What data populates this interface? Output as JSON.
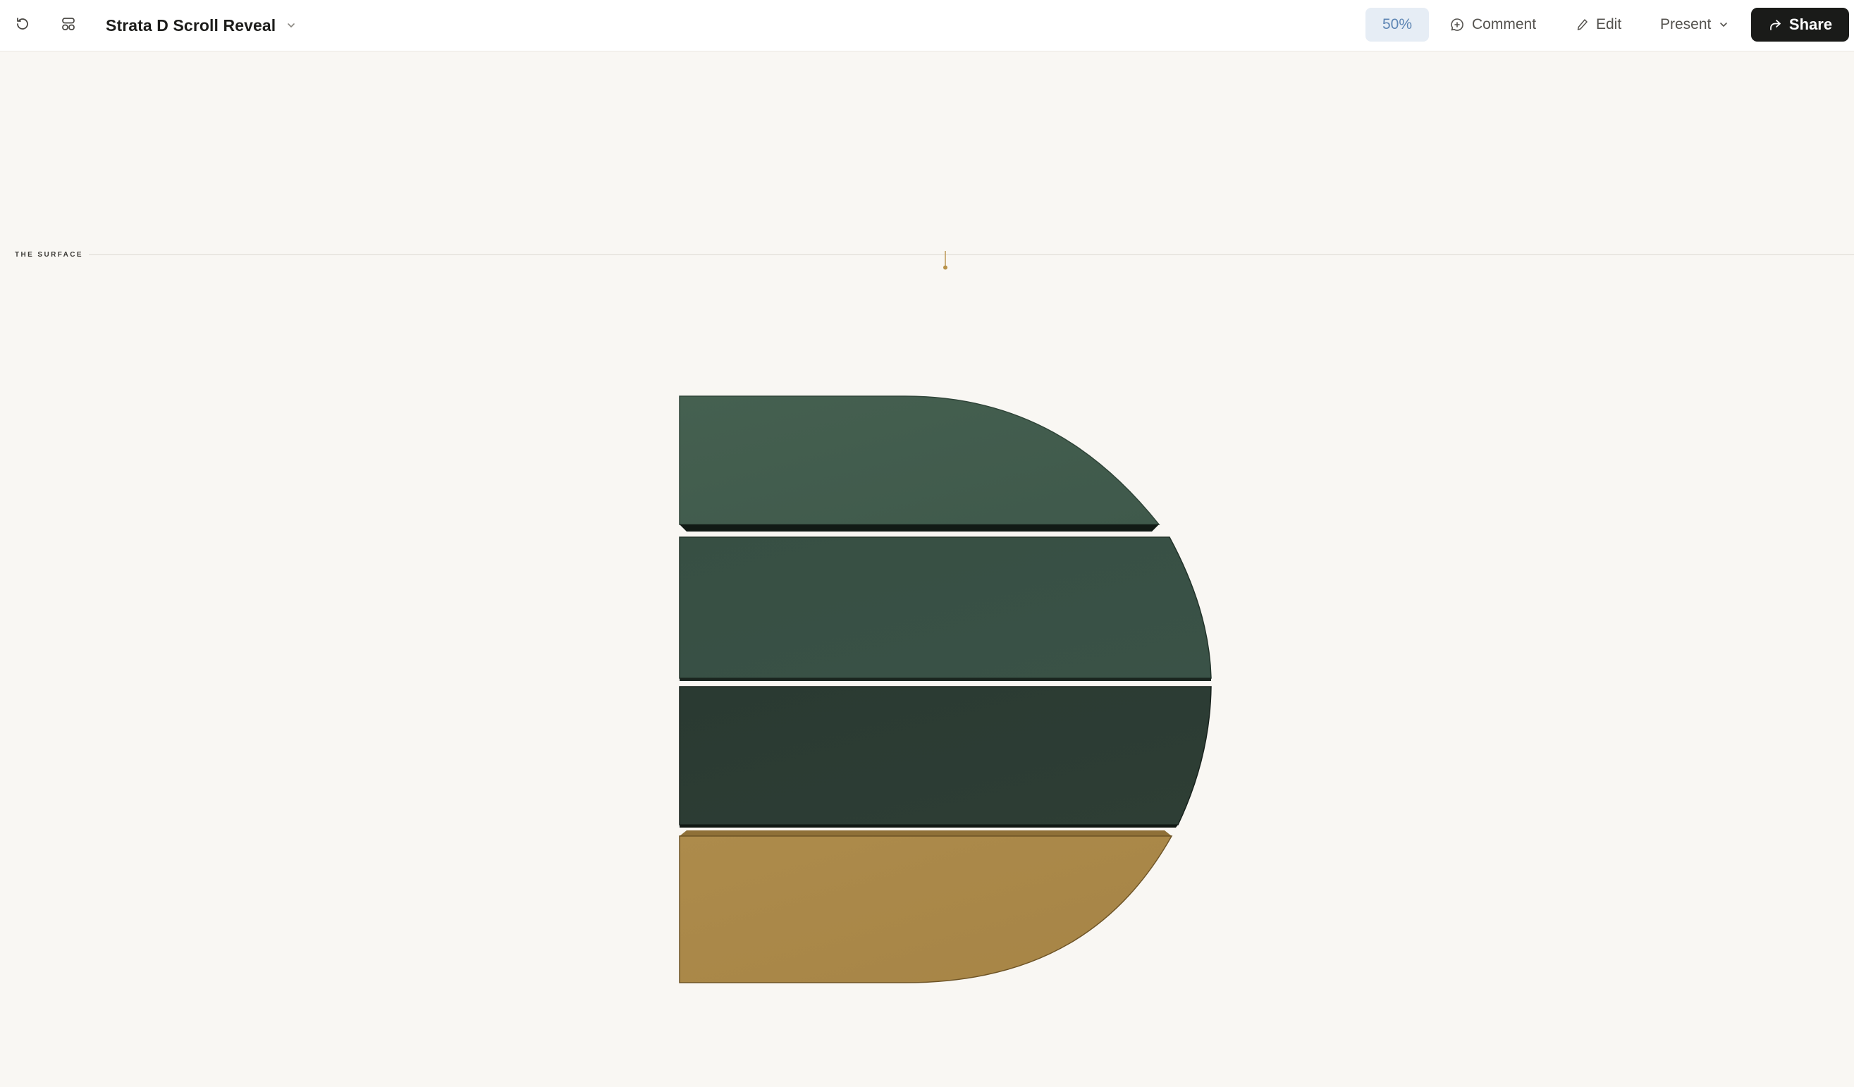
{
  "toolbar": {
    "title": "Strata D Scroll Reveal",
    "zoom": "50%",
    "comment_label": "Comment",
    "edit_label": "Edit",
    "present_label": "Present",
    "share_label": "Share"
  },
  "canvas": {
    "surface_label": "THE SURFACE"
  },
  "colors": {
    "layer_1": "#445e4f",
    "layer_2": "#385044",
    "layer_3": "#2b3b33",
    "layer_4": "#aa8849",
    "accent_marker": "#b8924a",
    "background": "#f9f7f3"
  },
  "icons": {
    "reload": "reload-icon",
    "layout": "layout-icon",
    "dropdown": "chevron-down-icon",
    "comment": "comment-icon",
    "edit": "pencil-icon",
    "share": "share-arrow-icon"
  }
}
